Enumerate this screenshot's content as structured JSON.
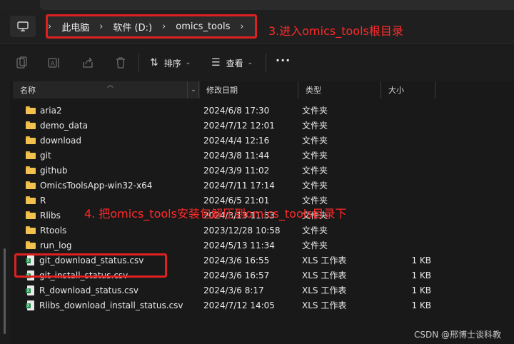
{
  "breadcrumb": [
    "此电脑",
    "软件 (D:)",
    "omics_tools"
  ],
  "annotations": {
    "step3": "3.进入omics_tools根目录",
    "step4": "4. 把omics_tools安装包解压到omics_tools目录下"
  },
  "toolbar": {
    "sort_label": "排序",
    "view_label": "查看",
    "more_label": "···"
  },
  "columns": {
    "name": "名称",
    "date": "修改日期",
    "type": "类型",
    "size": "大小"
  },
  "files": [
    {
      "name": "aria2",
      "date": "2024/6/8 17:30",
      "type": "文件夹",
      "size": "",
      "icon": "folder-icon"
    },
    {
      "name": "demo_data",
      "date": "2024/7/12 12:01",
      "type": "文件夹",
      "size": "",
      "icon": "folder-icon"
    },
    {
      "name": "download",
      "date": "2024/4/4 12:16",
      "type": "文件夹",
      "size": "",
      "icon": "folder-icon"
    },
    {
      "name": "git",
      "date": "2024/3/8 11:44",
      "type": "文件夹",
      "size": "",
      "icon": "folder-icon"
    },
    {
      "name": "github",
      "date": "2024/3/9 11:02",
      "type": "文件夹",
      "size": "",
      "icon": "folder-icon"
    },
    {
      "name": "OmicsToolsApp-win32-x64",
      "date": "2024/7/11 17:14",
      "type": "文件夹",
      "size": "",
      "icon": "folder-icon"
    },
    {
      "name": "R",
      "date": "2024/6/5 21:01",
      "type": "文件夹",
      "size": "",
      "icon": "folder-icon"
    },
    {
      "name": "Rlibs",
      "date": "2024/3/13 11:53",
      "type": "文件夹",
      "size": "",
      "icon": "folder-icon"
    },
    {
      "name": "Rtools",
      "date": "2023/12/28 10:58",
      "type": "文件夹",
      "size": "",
      "icon": "folder-icon"
    },
    {
      "name": "run_log",
      "date": "2024/5/13 11:34",
      "type": "文件夹",
      "size": "",
      "icon": "folder-icon"
    },
    {
      "name": "git_download_status.csv",
      "date": "2024/3/6 16:55",
      "type": "XLS 工作表",
      "size": "1 KB",
      "icon": "excel-file-icon"
    },
    {
      "name": "git_install_status.csv",
      "date": "2024/3/6 16:57",
      "type": "XLS 工作表",
      "size": "1 KB",
      "icon": "excel-file-icon"
    },
    {
      "name": "R_download_status.csv",
      "date": "2024/3/6 8:17",
      "type": "XLS 工作表",
      "size": "1 KB",
      "icon": "excel-file-icon"
    },
    {
      "name": "Rlibs_download_install_status.csv",
      "date": "2024/7/12 14:05",
      "type": "XLS 工作表",
      "size": "1 KB",
      "icon": "excel-file-icon"
    }
  ],
  "watermark": "CSDN @邢博士谈科教",
  "colors": {
    "annotation_red": "#ff2a2a",
    "folder_yellow": "#f2c14e",
    "excel_green": "#1f8a4c"
  }
}
